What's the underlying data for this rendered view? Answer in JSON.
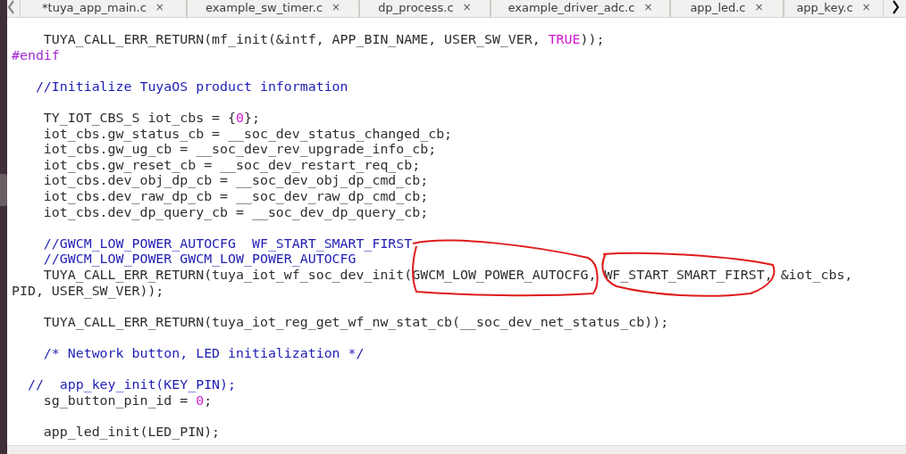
{
  "tabs": [
    {
      "label": "*tuya_app_main.c",
      "close": "×"
    },
    {
      "label": "example_sw_timer.c",
      "close": "×"
    },
    {
      "label": "dp_process.c",
      "close": "×"
    },
    {
      "label": "example_driver_adc.c",
      "close": "×"
    },
    {
      "label": "app_led.c",
      "close": "×"
    },
    {
      "label": "app_key.c",
      "close": "×"
    }
  ],
  "code_blocks": [
    [
      [
        {
          "kind": "plain",
          "text": "    TUYA_CALL_ERR_RETURN(mf_init(&intf, APP_BIN_NAME, USER_SW_VER, "
        },
        {
          "kind": "constant",
          "text": "TRUE"
        },
        {
          "kind": "plain",
          "text": "));"
        }
      ],
      [
        {
          "kind": "preprocessor",
          "text": "#endif"
        }
      ]
    ],
    [
      [
        {
          "kind": "comment",
          "text": "   //Initialize TuyaOS product information"
        }
      ]
    ],
    [
      [
        {
          "kind": "plain",
          "text": "    TY_IOT_CBS_S iot_cbs = {"
        },
        {
          "kind": "constant",
          "text": "0"
        },
        {
          "kind": "plain",
          "text": "};"
        }
      ],
      [
        {
          "kind": "plain",
          "text": "    iot_cbs.gw_status_cb = __soc_dev_status_changed_cb;"
        }
      ],
      [
        {
          "kind": "plain",
          "text": "    iot_cbs.gw_ug_cb = __soc_dev_rev_upgrade_info_cb;"
        }
      ],
      [
        {
          "kind": "plain",
          "text": "    iot_cbs.gw_reset_cb = __soc_dev_restart_req_cb;"
        }
      ],
      [
        {
          "kind": "plain",
          "text": "    iot_cbs.dev_obj_dp_cb = __soc_dev_obj_dp_cmd_cb;"
        }
      ],
      [
        {
          "kind": "plain",
          "text": "    iot_cbs.dev_raw_dp_cb = __soc_dev_raw_dp_cmd_cb;"
        }
      ],
      [
        {
          "kind": "plain",
          "text": "    iot_cbs.dev_dp_query_cb = __soc_dev_dp_query_cb;"
        }
      ]
    ],
    [
      [
        {
          "kind": "comment",
          "text": "    //GWCM_LOW_POWER_AUTOCFG  WF_START_SMART_FIRST"
        }
      ],
      [
        {
          "kind": "comment",
          "text": "    //GWCM_LOW_POWER GWCM_LOW_POWER_AUTOCFG"
        }
      ],
      [
        {
          "kind": "plain",
          "text": "    TUYA_CALL_ERR_RETURN(tuya_iot_wf_soc_dev_init(GWCM_LOW_POWER_AUTOCFG, WF_START_SMART_FIRST, &iot_cbs,"
        }
      ],
      [
        {
          "kind": "plain",
          "text": "PID, USER_SW_VER));"
        }
      ]
    ],
    [
      [
        {
          "kind": "plain",
          "text": "    TUYA_CALL_ERR_RETURN(tuya_iot_reg_get_wf_nw_stat_cb(__soc_dev_net_status_cb));"
        }
      ]
    ],
    [
      [
        {
          "kind": "comment",
          "text": "    /* Network button, LED initialization */"
        }
      ]
    ],
    [
      [
        {
          "kind": "comment",
          "text": "  //  app_key_init(KEY_PIN);"
        }
      ],
      [
        {
          "kind": "plain",
          "text": "    sg_button_pin_id = "
        },
        {
          "kind": "constant",
          "text": "0"
        },
        {
          "kind": "plain",
          "text": ";"
        }
      ]
    ],
    [
      [
        {
          "kind": "plain",
          "text": "    app_led_init(LED_PIN);"
        }
      ]
    ]
  ],
  "annotations": [
    {
      "kind": "freehand-loop"
    },
    {
      "kind": "freehand-loop"
    }
  ]
}
